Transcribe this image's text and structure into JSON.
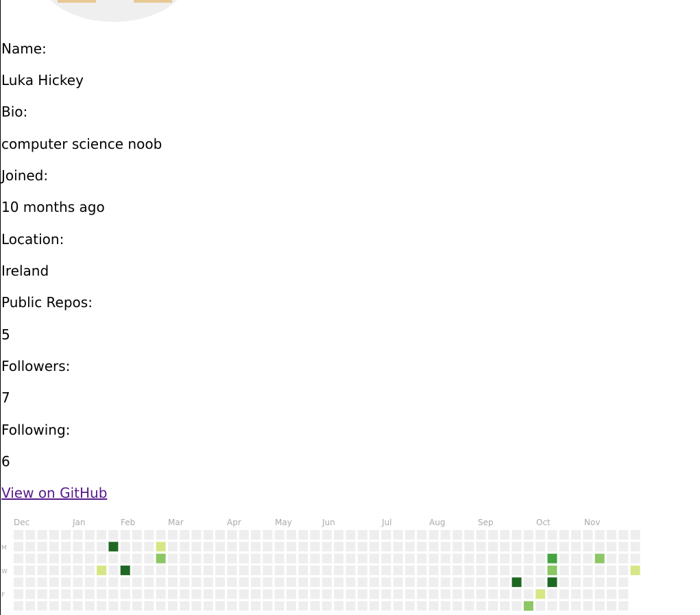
{
  "profile": {
    "name_label": "Name:",
    "name_value": "Luka Hickey",
    "bio_label": "Bio:",
    "bio_value": "computer science noob",
    "joined_label": "Joined:",
    "joined_value": "10 months ago",
    "location_label": "Location:",
    "location_value": "Ireland",
    "repos_label": "Public Repos:",
    "repos_value": "5",
    "followers_label": "Followers:",
    "followers_value": "7",
    "following_label": "Following:",
    "following_value": "6",
    "github_link_label": "View on GitHub"
  },
  "contributions": {
    "month_labels": [
      "Dec",
      "Jan",
      "Feb",
      "Mar",
      "Apr",
      "May",
      "Jun",
      "Jul",
      "Aug",
      "Sep",
      "Oct",
      "Nov"
    ],
    "day_labels": [
      "M",
      "W",
      "F"
    ],
    "colors": [
      "#eeeeee",
      "#d6e685",
      "#8cc665",
      "#44a340",
      "#1e6823"
    ],
    "weeks": 53,
    "last_week_days": 4,
    "active_cells": [
      {
        "week": 8,
        "day": 1,
        "level": 4
      },
      {
        "week": 12,
        "day": 1,
        "level": 1
      },
      {
        "week": 12,
        "day": 2,
        "level": 2
      },
      {
        "week": 7,
        "day": 3,
        "level": 1
      },
      {
        "week": 9,
        "day": 3,
        "level": 4
      },
      {
        "week": 45,
        "day": 2,
        "level": 3
      },
      {
        "week": 49,
        "day": 2,
        "level": 2
      },
      {
        "week": 45,
        "day": 3,
        "level": 2
      },
      {
        "week": 52,
        "day": 3,
        "level": 1
      },
      {
        "week": 42,
        "day": 4,
        "level": 4
      },
      {
        "week": 45,
        "day": 4,
        "level": 4
      },
      {
        "week": 44,
        "day": 5,
        "level": 1
      },
      {
        "week": 43,
        "day": 6,
        "level": 2
      }
    ]
  }
}
